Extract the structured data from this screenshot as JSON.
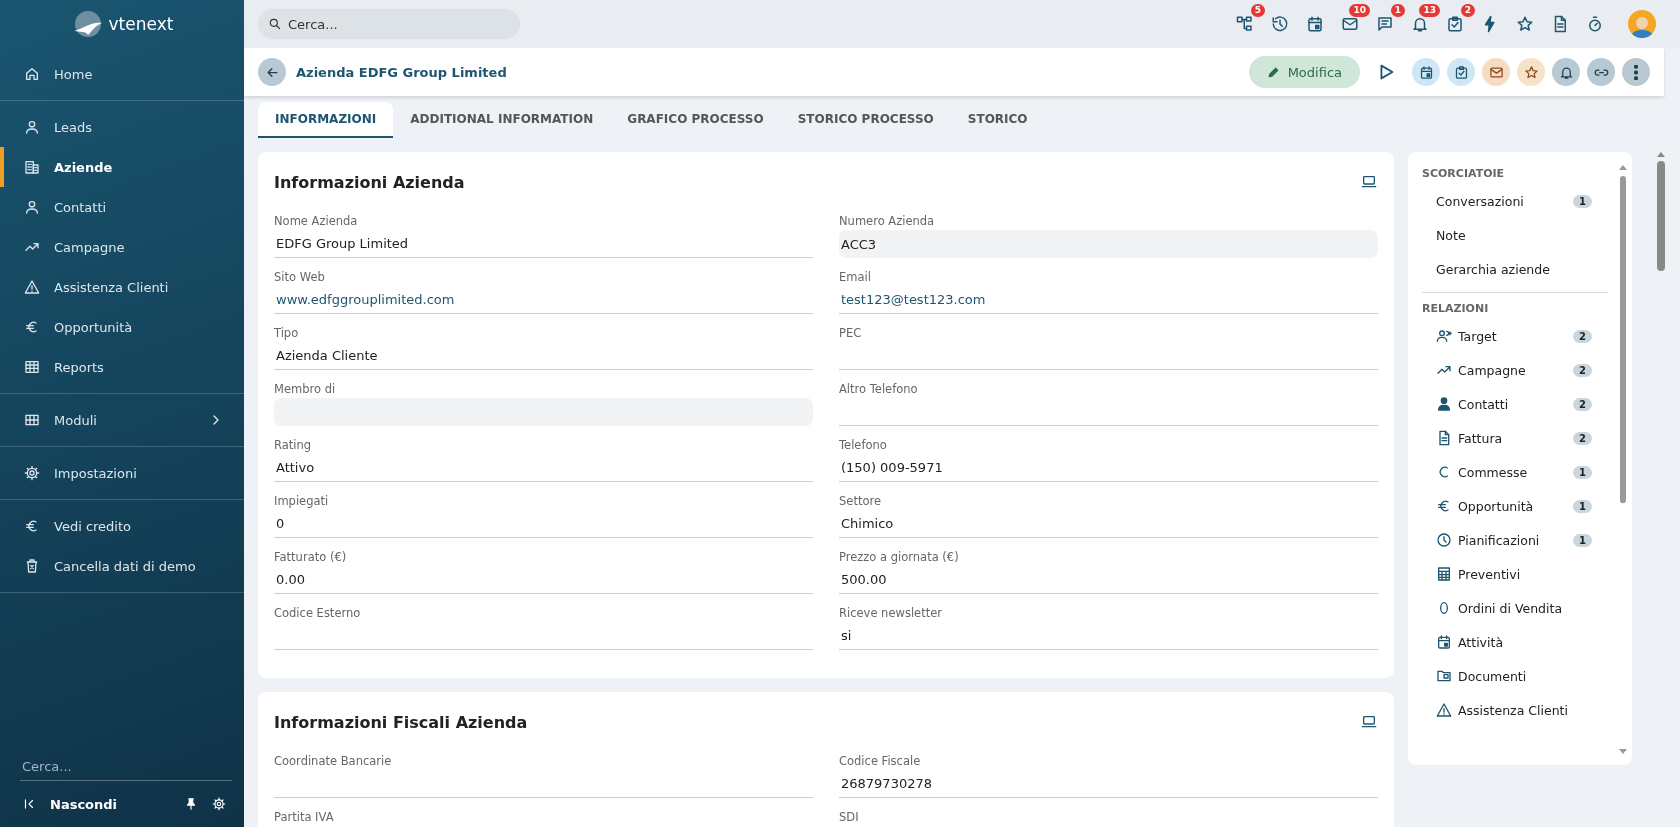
{
  "sidebar": {
    "logo": "vtenext",
    "groups": [
      [
        {
          "label": "Home",
          "selected": false
        }
      ],
      [
        {
          "label": "Leads",
          "selected": false
        },
        {
          "label": "Aziende",
          "selected": true
        },
        {
          "label": "Contatti",
          "selected": false
        },
        {
          "label": "Campagne",
          "selected": false
        },
        {
          "label": "Assistenza Clienti",
          "selected": false
        },
        {
          "label": "Opportunità",
          "selected": false
        },
        {
          "label": "Reports",
          "selected": false
        }
      ],
      [
        {
          "label": "Moduli",
          "selected": false
        }
      ],
      [
        {
          "label": "Impostazioni",
          "selected": false
        }
      ],
      [
        {
          "label": "Vedi credito",
          "selected": false
        },
        {
          "label": "Cancella dati di demo",
          "selected": false
        }
      ]
    ],
    "search": {
      "placeholder": "Cerca..."
    },
    "footer": {
      "label": "Nascondi"
    }
  },
  "topbar": {
    "search": {
      "placeholder": "Cerca..."
    },
    "icons": [
      {
        "kind": "badged",
        "badge": "5"
      },
      {
        "kind": "plain"
      },
      {
        "kind": "plain"
      },
      {
        "kind": "badged",
        "badge": "10"
      },
      {
        "kind": "badged",
        "badge": "1"
      },
      {
        "kind": "badged",
        "badge": "13"
      },
      {
        "kind": "badged",
        "badge": "2"
      },
      {
        "kind": "plain"
      },
      {
        "kind": "plain"
      },
      {
        "kind": "plain"
      },
      {
        "kind": "plain"
      }
    ]
  },
  "header": {
    "title": "Azienda EDFG Group Limited",
    "edit_button": "Modifica"
  },
  "tabs": [
    {
      "label": "INFORMAZIONI",
      "selected": true
    },
    {
      "label": "ADDITIONAL INFORMATION",
      "selected": false
    },
    {
      "label": "GRAFICO PROCESSO",
      "selected": false
    },
    {
      "label": "STORICO PROCESSO",
      "selected": false
    },
    {
      "label": "STORICO",
      "selected": false
    }
  ],
  "sections": [
    {
      "title": "Informazioni Azienda",
      "fields": [
        {
          "label": "Nome Azienda",
          "value": "EDFG Group Limited",
          "kind": "text"
        },
        {
          "label": "Numero Azienda",
          "value": "ACC3",
          "kind": "readonly"
        },
        {
          "label": "Sito Web",
          "value": "www.edfggrouplimited.com",
          "kind": "link"
        },
        {
          "label": "Email",
          "value": "test123@test123.com",
          "kind": "link"
        },
        {
          "label": "Tipo",
          "value": "Azienda Cliente",
          "kind": "text"
        },
        {
          "label": "PEC",
          "kind": "text"
        },
        {
          "label": "Membro di",
          "kind": "readonly"
        },
        {
          "label": "Altro Telefono",
          "kind": "text"
        },
        {
          "label": "Rating",
          "value": "Attivo",
          "kind": "text"
        },
        {
          "label": "Telefono",
          "value": "(150) 009-5971",
          "kind": "text"
        },
        {
          "label": "Impiegati",
          "value": "0",
          "kind": "text"
        },
        {
          "label": "Settore",
          "value": "Chimico",
          "kind": "text"
        },
        {
          "label": "Fatturato (€)",
          "value": "0.00",
          "kind": "text"
        },
        {
          "label": "Prezzo a giornata (€)",
          "value": "500.00",
          "kind": "text"
        },
        {
          "label": "Codice Esterno",
          "kind": "text"
        },
        {
          "label": "Riceve newsletter",
          "value": "si",
          "kind": "text"
        }
      ]
    },
    {
      "title": "Informazioni Fiscali Azienda",
      "fields": [
        {
          "label": "Coordinate Bancarie",
          "kind": "text"
        },
        {
          "label": "Codice Fiscale",
          "value": "26879730278",
          "kind": "text"
        },
        {
          "label": "Partita IVA",
          "kind": "text"
        },
        {
          "label": "SDI",
          "kind": "text"
        }
      ]
    }
  ],
  "side_panel": {
    "shortcuts_title": "SCORCIATOIE",
    "shortcuts": [
      {
        "label": "Conversazioni",
        "count": "1"
      },
      {
        "label": "Note"
      },
      {
        "label": "Gerarchia aziende"
      }
    ],
    "relations_title": "RELAZIONI",
    "relations": [
      {
        "label": "Target",
        "count": "2"
      },
      {
        "label": "Campagne",
        "count": "2"
      },
      {
        "label": "Contatti",
        "count": "2"
      },
      {
        "label": "Fattura",
        "count": "2"
      },
      {
        "label": "Commesse",
        "count": "1"
      },
      {
        "label": "Opportunità",
        "count": "1"
      },
      {
        "label": "Pianificazioni",
        "count": "1"
      },
      {
        "label": "Preventivi"
      },
      {
        "label": "Ordini di Vendita"
      },
      {
        "label": "Attività"
      },
      {
        "label": "Documenti"
      },
      {
        "label": "Assistenza Clienti"
      }
    ]
  }
}
